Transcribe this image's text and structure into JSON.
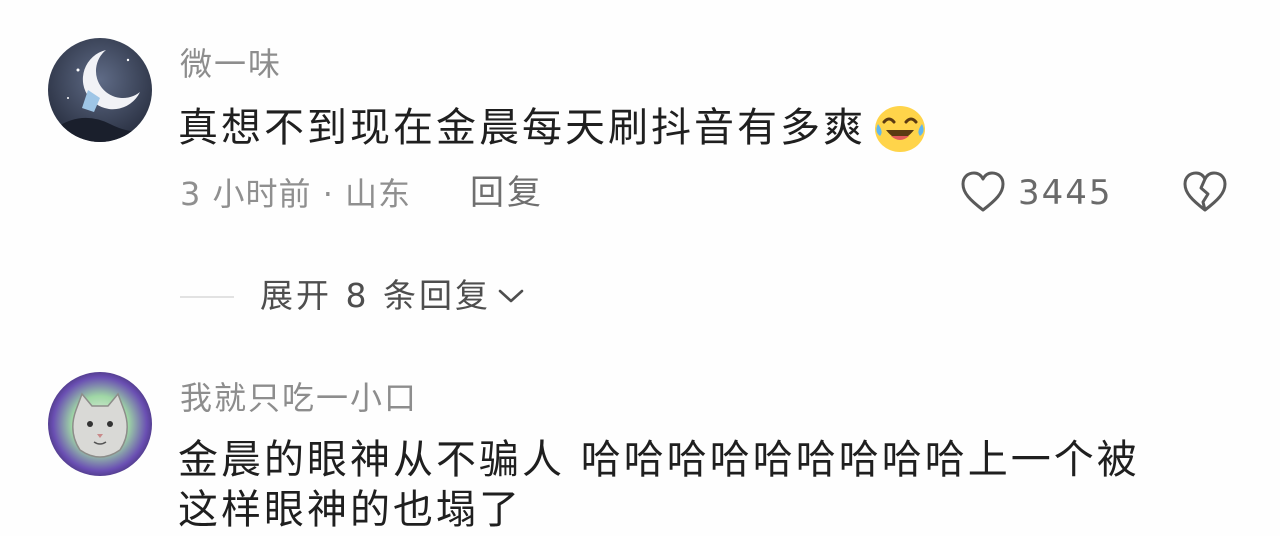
{
  "comments": [
    {
      "username": "微一味",
      "text": "真想不到现在金晨每天刷抖音有多爽",
      "emoji_icon": "laughing-crying-emoji",
      "meta": "3 小时前 · 山东",
      "reply_label": "回复",
      "like_icon": "heart-outline",
      "like_count": "3445",
      "dislike_icon": "broken-heart-outline",
      "expand_replies_label": "展开 8 条回复"
    },
    {
      "username": "我就只吃一小口",
      "text_line1": "金晨的眼神从不骗人 哈哈哈哈哈哈哈哈哈上一个被",
      "text_line2": "这样眼神的也塌了"
    }
  ],
  "colors": {
    "background": "#fefefe",
    "username": "#8d8d8d",
    "content_text": "#1f1f1f",
    "meta_text": "#8f8f8f",
    "divider": "#e2e2e2"
  }
}
